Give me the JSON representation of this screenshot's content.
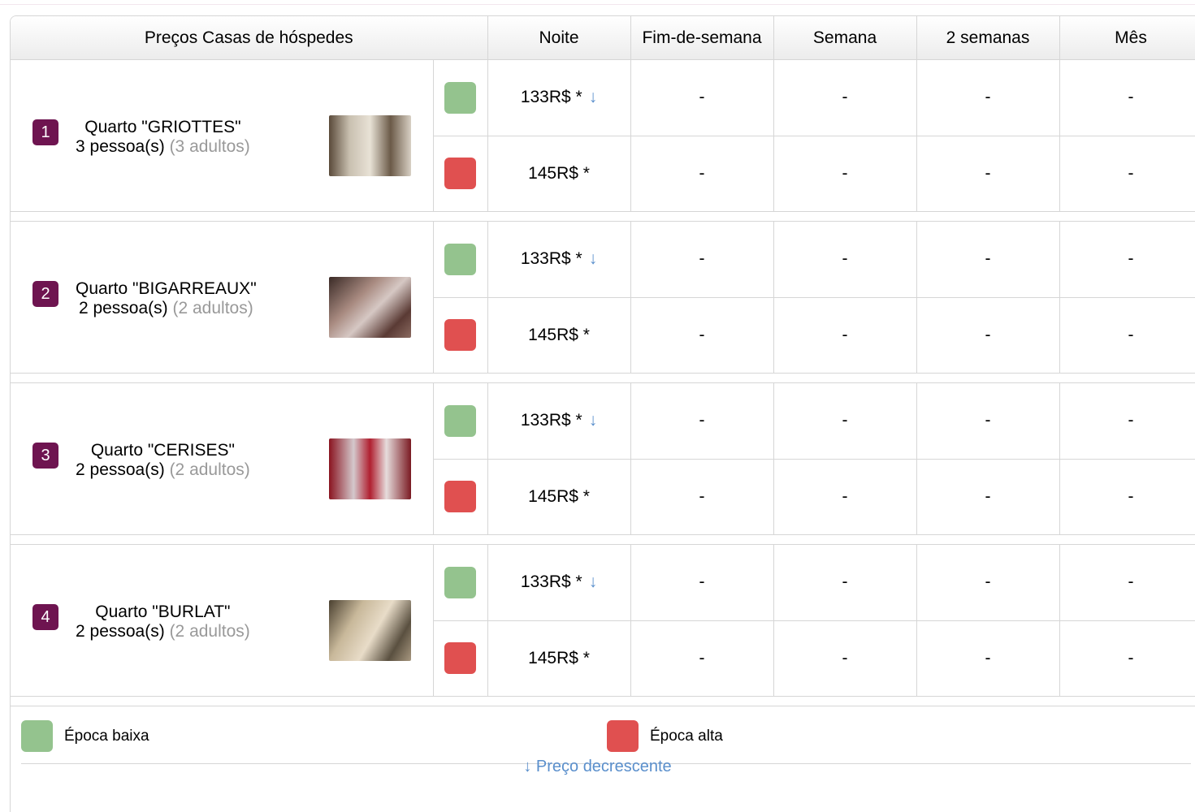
{
  "header": {
    "title": "Preços Casas de hóspedes",
    "columns": [
      "Noite",
      "Fim-de-semana",
      "Semana",
      "2 semanas",
      "Mês"
    ]
  },
  "colors": {
    "low_season": "#94c38e",
    "high_season": "#e05050",
    "badge": "#6e1450",
    "link": "#5a8fcc"
  },
  "rooms": [
    {
      "number": "1",
      "name": "Quarto \"GRIOTTES\"",
      "capacity": "3 pessoa(s)",
      "adults": "(3 adultos)",
      "low": {
        "night": "133R$ *",
        "arrow": "↓",
        "weekend": "-",
        "week": "-",
        "two_weeks": "-",
        "month": "-"
      },
      "high": {
        "night": "145R$ *",
        "weekend": "-",
        "week": "-",
        "two_weeks": "-",
        "month": "-"
      }
    },
    {
      "number": "2",
      "name": "Quarto \"BIGARREAUX\"",
      "capacity": "2 pessoa(s)",
      "adults": "(2 adultos)",
      "low": {
        "night": "133R$ *",
        "arrow": "↓",
        "weekend": "-",
        "week": "-",
        "two_weeks": "-",
        "month": "-"
      },
      "high": {
        "night": "145R$ *",
        "weekend": "-",
        "week": "-",
        "two_weeks": "-",
        "month": "-"
      }
    },
    {
      "number": "3",
      "name": "Quarto \"CERISES\"",
      "capacity": "2 pessoa(s)",
      "adults": "(2 adultos)",
      "low": {
        "night": "133R$ *",
        "arrow": "↓",
        "weekend": "-",
        "week": "-",
        "two_weeks": "-",
        "month": "-"
      },
      "high": {
        "night": "145R$ *",
        "weekend": "-",
        "week": "-",
        "two_weeks": "-",
        "month": "-"
      }
    },
    {
      "number": "4",
      "name": "Quarto \"BURLAT\"",
      "capacity": "2 pessoa(s)",
      "adults": "(2 adultos)",
      "low": {
        "night": "133R$ *",
        "arrow": "↓",
        "weekend": "-",
        "week": "-",
        "two_weeks": "-",
        "month": "-"
      },
      "high": {
        "night": "145R$ *",
        "weekend": "-",
        "week": "-",
        "two_weeks": "-",
        "month": "-"
      }
    }
  ],
  "legend": {
    "low_label": "Época baixa",
    "high_label": "Época alta"
  },
  "sort": {
    "label": "↓ Preço decrescente"
  }
}
